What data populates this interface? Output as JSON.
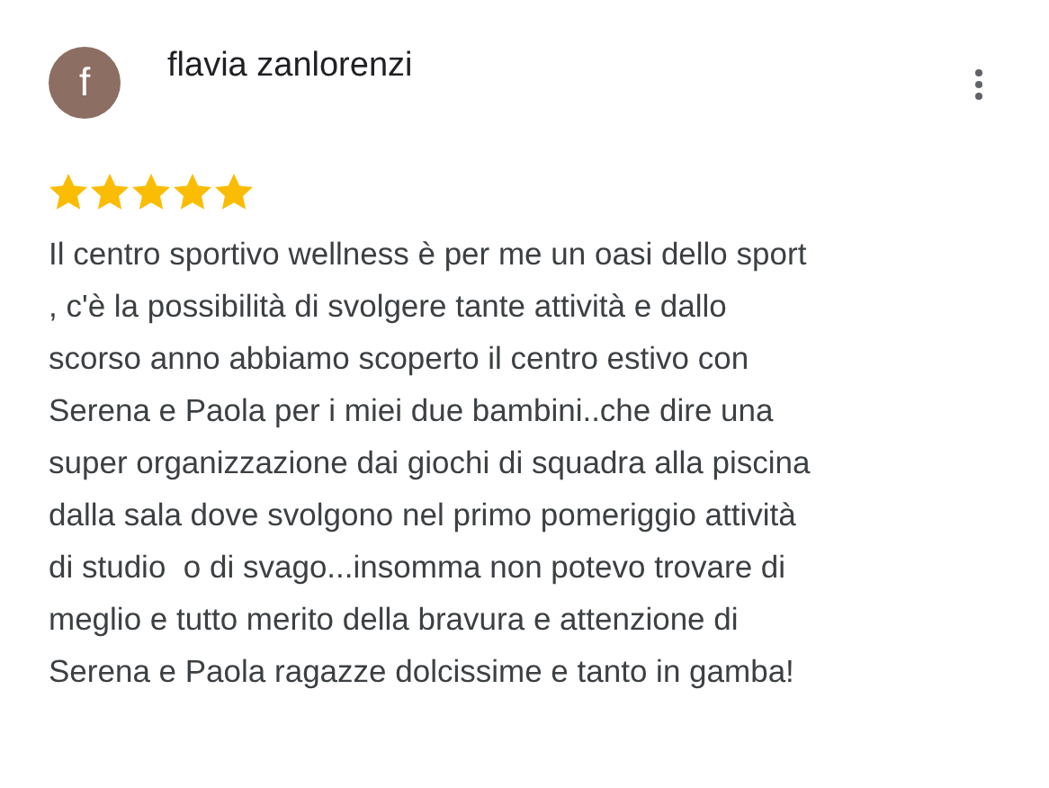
{
  "review": {
    "avatar_letter": "f",
    "author": "flavia zanlorenzi",
    "stars": 5,
    "text": "Il centro sportivo wellness è per me un oasi dello sport\n, c'è la possibilità di svolgere tante attività e dallo\nscorso anno abbiamo scoperto il centro estivo con\nSerena e Paola per i miei due bambini..che dire una\nsuper organizzazione dai giochi di squadra alla piscina\ndalla sala dove svolgono nel primo pomeriggio attività\ndi studio  o di svago...insomma non potevo trovare di\nmeglio e tutto merito della bravura e attenzione di\nSerena e Paola ragazze dolcissime e tanto in gamba!"
  }
}
